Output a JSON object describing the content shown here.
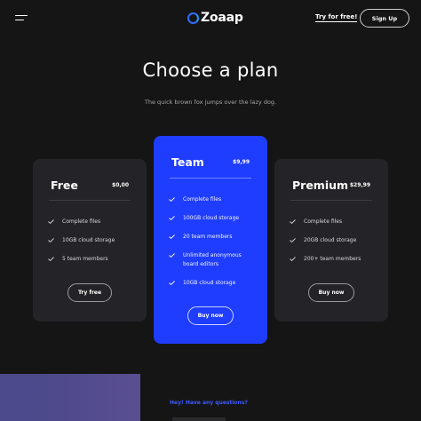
{
  "header": {
    "menu_icon": "hamburger-icon",
    "logo_text": "Zoaap",
    "logo_icon": "ring-logo-icon",
    "try_link": "Try for free!",
    "signup_label": "Sign Up"
  },
  "hero": {
    "title": "Choose a plan",
    "subtitle": "The quick brown fox jumps over the lazy dog."
  },
  "plans": [
    {
      "name": "Free",
      "price": "$0,00",
      "features": [
        "Complete files",
        "10GB cloud storage",
        "5 team members"
      ],
      "button_label": "Try free"
    },
    {
      "name": "Team",
      "price": "$9,99",
      "features": [
        "Complete files",
        "100GB cloud storage",
        "20 team members",
        "Unlimited anonymous\nboard editors",
        "10GB cloud storage"
      ],
      "button_label": "Buy now"
    },
    {
      "name": "Premium",
      "price": "$29,99",
      "features": [
        "Complete files",
        "20GB cloud storage",
        "200+ team members"
      ],
      "button_label": "Buy now"
    }
  ],
  "footer": {
    "question": "Hey! Have any questions?"
  },
  "colors": {
    "background": "#151515",
    "card": "#242428",
    "accent": "#1f3dff",
    "link_accent": "#3d5bff"
  }
}
